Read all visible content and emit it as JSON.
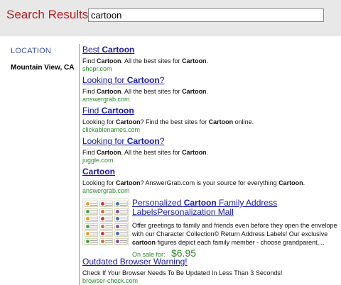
{
  "search": {
    "label": "Search Results for:",
    "query": "cartoon"
  },
  "sidebar": {
    "title": "LOCATION",
    "location": "Mountain View, CA"
  },
  "results": [
    {
      "title_pre": "Best ",
      "title_bold": "Cartoon",
      "title_post": "",
      "desc": [
        {
          "t": "Find ",
          "b": false
        },
        {
          "t": "Cartoon",
          "b": true
        },
        {
          "t": ". All the best sites for ",
          "b": false
        },
        {
          "t": "Cartoon",
          "b": true
        },
        {
          "t": ".",
          "b": false
        }
      ],
      "url": "shopr.com"
    },
    {
      "title_pre": "Looking for ",
      "title_bold": "Cartoon",
      "title_post": "?",
      "desc": [
        {
          "t": "Find ",
          "b": false
        },
        {
          "t": "Cartoon",
          "b": true
        },
        {
          "t": ". All the best sites for ",
          "b": false
        },
        {
          "t": "Cartoon",
          "b": true
        },
        {
          "t": ".",
          "b": false
        }
      ],
      "url": "answergrab.com"
    },
    {
      "title_pre": "Find ",
      "title_bold": "Cartoon",
      "title_post": "",
      "desc": [
        {
          "t": "Looking for ",
          "b": false
        },
        {
          "t": "Cartoon",
          "b": true
        },
        {
          "t": "? Find the best sites for ",
          "b": false
        },
        {
          "t": "Cartoon",
          "b": true
        },
        {
          "t": " online.",
          "b": false
        }
      ],
      "url": "clickablenames.com"
    },
    {
      "title_pre": "Looking for ",
      "title_bold": "Cartoon",
      "title_post": "?",
      "desc": [
        {
          "t": "Find ",
          "b": false
        },
        {
          "t": "Cartoon",
          "b": true
        },
        {
          "t": ". All the best sites for ",
          "b": false
        },
        {
          "t": "Cartoon",
          "b": true
        },
        {
          "t": ".",
          "b": false
        }
      ],
      "url": "juggle.com"
    },
    {
      "title_pre": "",
      "title_bold": "Cartoon",
      "title_post": "",
      "desc": [
        {
          "t": "Looking for ",
          "b": false
        },
        {
          "t": "Cartoon",
          "b": true
        },
        {
          "t": "? AnswerGrab.com is your source for everything ",
          "b": false
        },
        {
          "t": "Cartoon",
          "b": true
        },
        {
          "t": ".",
          "b": false
        }
      ],
      "url": "answergrab.com"
    }
  ],
  "ad": {
    "title_pre": "Personalized ",
    "title_bold": "Cartoon",
    "title_post": " Family Address LabelsPersonalization Mall",
    "desc": [
      {
        "t": "Offer greetings to family and friends even before they open the envelope with our Character Collection© Return Address Labels! Our exclusive ",
        "b": false
      },
      {
        "t": "cartoon",
        "b": true
      },
      {
        "t": " figures depict each family member - choose grandparent,...",
        "b": false
      }
    ],
    "sale_label": "On sale for:",
    "price": "$6.95",
    "image_icon": "address-labels-sheet"
  },
  "last_result": {
    "title": "Outdated Browser Warning!",
    "desc": "Check If Your Browser Needs To Be Updated In Less Than 3 Seconds!",
    "url": "browser-check.com"
  },
  "colors": {
    "search_label": "#b22222",
    "link": "#1a1aa6",
    "url": "#2e8b2e",
    "location_title": "#3b52b0",
    "topbar_bg": "#e8e8e8"
  }
}
